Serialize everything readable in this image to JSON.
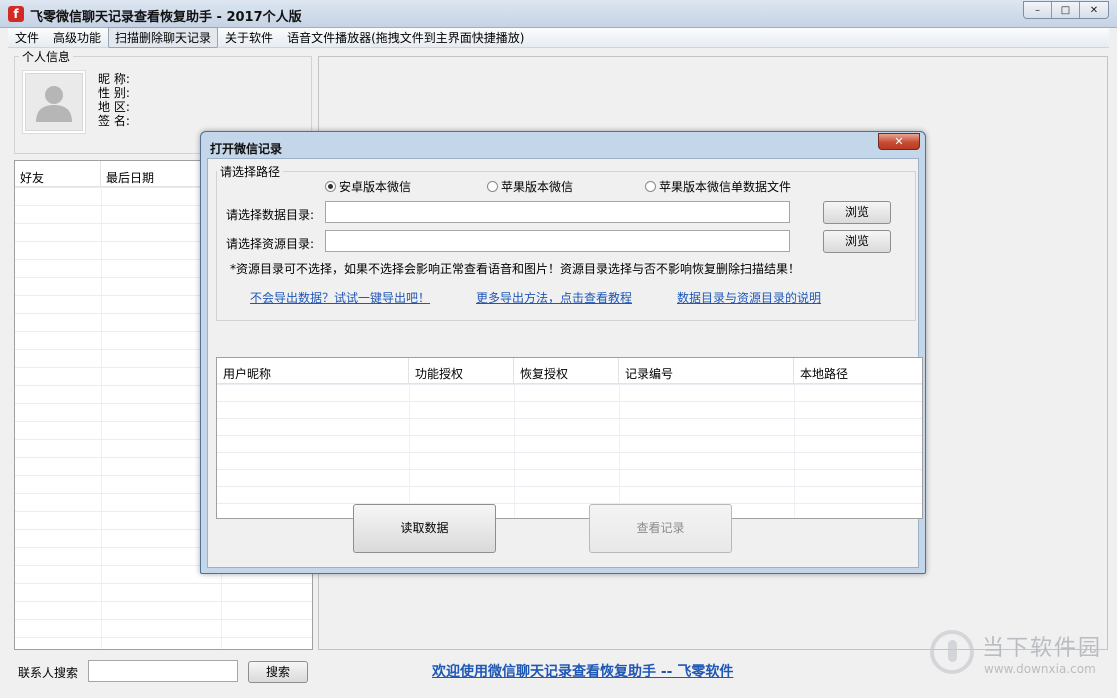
{
  "window": {
    "icon_glyph": "f",
    "title": "飞零微信聊天记录查看恢复助手 - 2017个人版",
    "controls": {
      "minimize": "–",
      "maximize": "□",
      "close": "✕"
    }
  },
  "menu": {
    "items": [
      {
        "label": "文件"
      },
      {
        "label": "高级功能"
      },
      {
        "label": "扫描删除聊天记录"
      },
      {
        "label": "关于软件"
      },
      {
        "label": "语音文件播放器(拖拽文件到主界面快捷播放)"
      }
    ]
  },
  "profile": {
    "group_title": "个人信息",
    "fields": [
      {
        "label": "昵 称:"
      },
      {
        "label": "性 别:"
      },
      {
        "label": "地 区:"
      },
      {
        "label": "签 名:"
      }
    ]
  },
  "friends": {
    "columns": [
      "好友",
      "最后日期"
    ]
  },
  "bottom": {
    "search_label": "联系人搜索",
    "search_value": "",
    "search_button": "搜索",
    "welcome": "欢迎使用微信聊天记录查看恢复助手 -- 飞零软件"
  },
  "watermark": {
    "text": "当下软件园",
    "url": "www.downxia.com"
  },
  "dialog": {
    "title": "打开微信记录",
    "close_glyph": "✕",
    "path_group_title": "请选择路径",
    "radios": [
      {
        "label": "安卓版本微信",
        "checked": true
      },
      {
        "label": "苹果版本微信",
        "checked": false
      },
      {
        "label": "苹果版本微信单数据文件",
        "checked": false
      }
    ],
    "data_dir_label": "请选择数据目录:",
    "data_dir_value": "",
    "res_dir_label": "请选择资源目录:",
    "res_dir_value": "",
    "browse_label": "浏览",
    "note": "*资源目录可不选择，如果不选择会影响正常查看语音和图片！资源目录选择与否不影响恢复删除扫描结果！",
    "links": [
      "不会导出数据？试试一键导出吧！",
      "更多导出方法，点击查看教程",
      "数据目录与资源目录的说明"
    ],
    "table_columns": [
      "用户昵称",
      "功能授权",
      "恢复授权",
      "记录编号",
      "本地路径"
    ],
    "read_button": "读取数据",
    "view_button": "查看记录"
  }
}
